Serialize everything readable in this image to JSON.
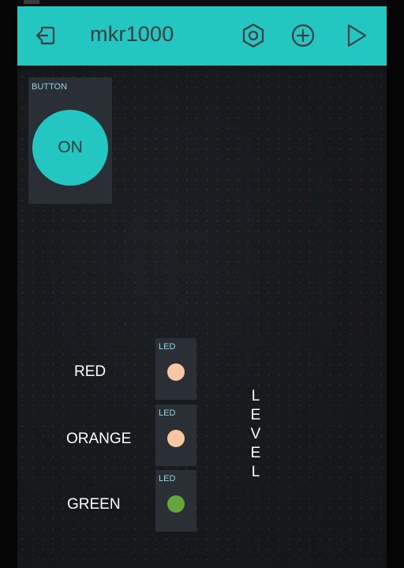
{
  "header": {
    "title": "mkr1000",
    "background": "#23c6c0",
    "icons": [
      "back-icon",
      "settings-icon",
      "add-icon",
      "play-icon"
    ]
  },
  "button_widget": {
    "label": "BUTTON",
    "state_text": "ON",
    "color": "#23c6c0"
  },
  "leds": [
    {
      "label": "LED",
      "color": "#f6c7a4"
    },
    {
      "label": "LED",
      "color": "#f6c7a4"
    },
    {
      "label": "LED",
      "color": "#66a53a"
    }
  ],
  "annotations": {
    "red": "RED",
    "orange": "ORANGE",
    "green": "GREEN",
    "level_letters": [
      "L",
      "E",
      "V",
      "E",
      "L"
    ]
  }
}
